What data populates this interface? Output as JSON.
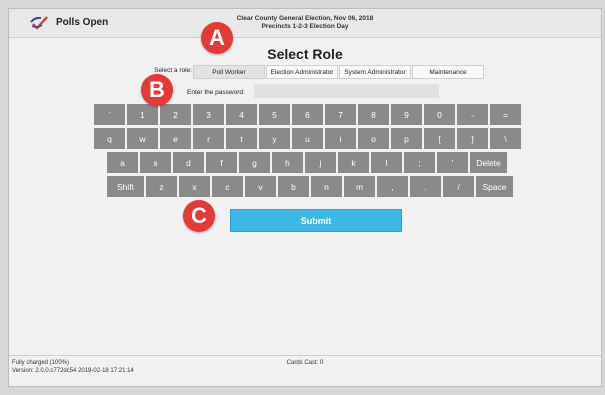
{
  "header": {
    "app_title": "Polls Open",
    "election_line1": "Clear County General Election, Nov 06, 2018",
    "election_line2": "Precincts 1-2-3 Election Day"
  },
  "page_title": "Select Role",
  "role": {
    "label": "Select a role:",
    "options": [
      "Poll Worker",
      "Election Administrator",
      "System Administrator",
      "Maintenance"
    ],
    "selected": "Poll Worker"
  },
  "password": {
    "label": "Enter the password:",
    "value": ""
  },
  "keyboard": {
    "rows": [
      [
        "`",
        "1",
        "2",
        "3",
        "4",
        "5",
        "6",
        "7",
        "8",
        "9",
        "0",
        "-",
        "="
      ],
      [
        "q",
        "w",
        "e",
        "r",
        "t",
        "y",
        "u",
        "i",
        "o",
        "p",
        "[",
        "]",
        "\\"
      ],
      [
        "a",
        "s",
        "d",
        "f",
        "g",
        "h",
        "j",
        "k",
        "l",
        ";",
        "'",
        "Delete"
      ],
      [
        "Shift",
        "z",
        "x",
        "c",
        "v",
        "b",
        "n",
        "m",
        ",",
        ".",
        "/",
        "Space"
      ]
    ]
  },
  "submit_label": "Submit",
  "footer": {
    "battery": "Fully charged (100%)",
    "version": "Version: 2.0.0.c772dc54 2019-02-18 17:21:14",
    "cards_cast": "Cards Cast: 0"
  },
  "markers": [
    "A",
    "B",
    "C"
  ],
  "colors": {
    "key_bg": "#8a8a8a",
    "submit_bg": "#3db7e4",
    "marker_bg": "#e53935"
  },
  "icons": {
    "logo": "checkmark-logo-icon"
  }
}
